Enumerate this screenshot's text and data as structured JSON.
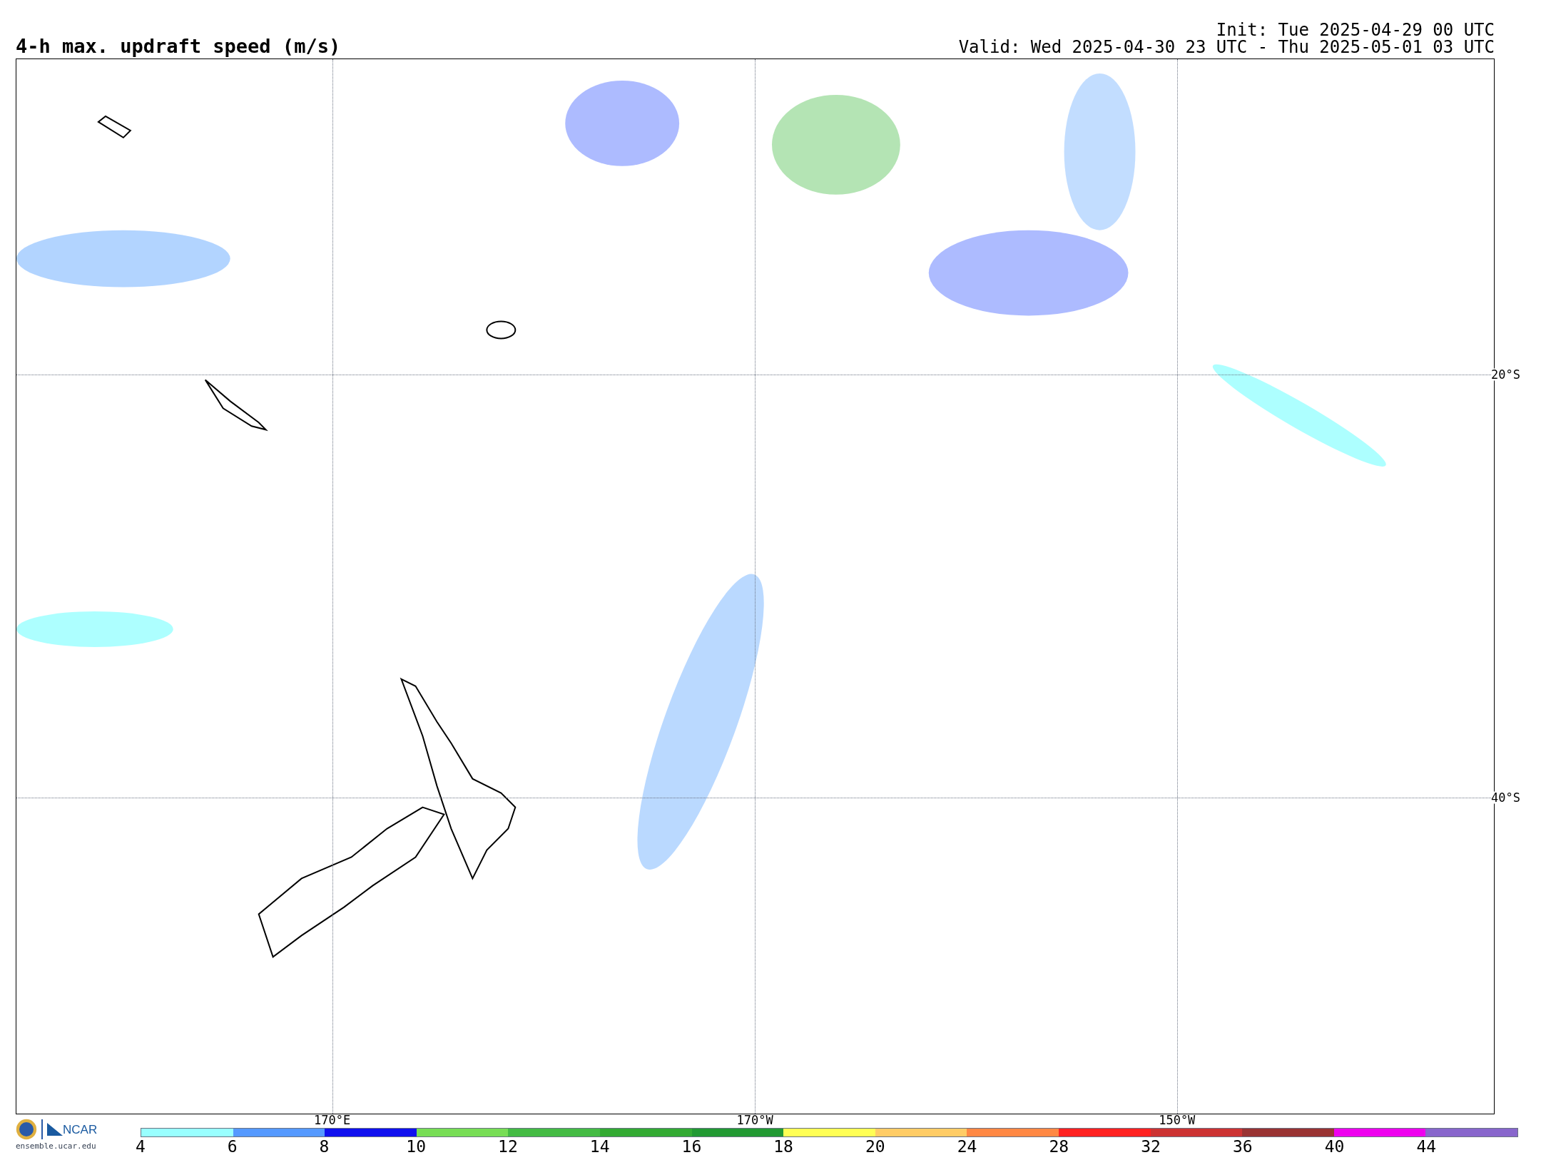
{
  "title": "4-h max. updraft speed (m/s)",
  "init": "Init: Tue 2025-04-29 00 UTC",
  "valid": "Valid: Wed 2025-04-30 23 UTC - Thu 2025-05-01 03 UTC",
  "map": {
    "longitude_labels": [
      "170°E",
      "170°W",
      "150°W"
    ],
    "latitude_labels": [
      "20°S",
      "40°S"
    ]
  },
  "legend": {
    "segments": [
      {
        "color": "#99ffff"
      },
      {
        "color": "#5599ff"
      },
      {
        "color": "#1010ee"
      },
      {
        "color": "#77dd55"
      },
      {
        "color": "#44bb44"
      },
      {
        "color": "#33aa33"
      },
      {
        "color": "#229933"
      },
      {
        "color": "#ffff55"
      },
      {
        "color": "#ffcc66"
      },
      {
        "color": "#ff8844"
      },
      {
        "color": "#ff2222"
      },
      {
        "color": "#cc3333"
      },
      {
        "color": "#993333"
      },
      {
        "color": "#ee00ee"
      },
      {
        "color": "#8866cc"
      }
    ],
    "labels": [
      "4",
      "6",
      "8",
      "10",
      "12",
      "14",
      "16",
      "18",
      "20",
      "24",
      "28",
      "32",
      "36",
      "40",
      "44"
    ]
  },
  "footer": {
    "logo_text": "NCAR",
    "url": "ensemble.ucar.edu"
  }
}
